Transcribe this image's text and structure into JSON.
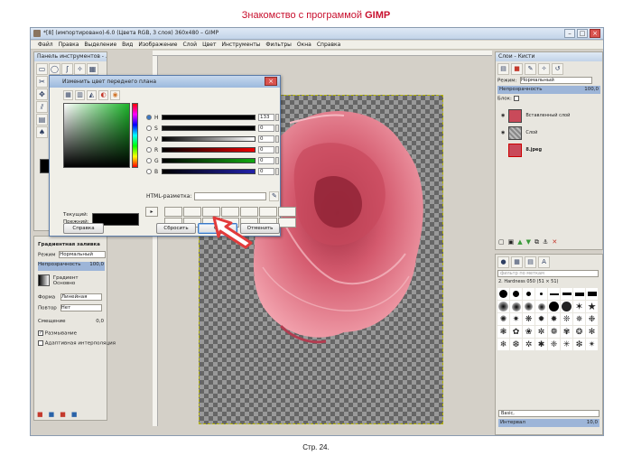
{
  "slide": {
    "title_prefix": "Знакомство с программой ",
    "title_strong": "GIMP",
    "page_label": "Стр. 24."
  },
  "window": {
    "title": "*[8] (импортировано)-6.0 (Цвета RGB, 3 слоя) 360x480 – GIMP"
  },
  "menu": [
    "Файл",
    "Правка",
    "Выделение",
    "Вид",
    "Изображение",
    "Слой",
    "Цвет",
    "Инструменты",
    "Фильтры",
    "Окна",
    "Справка"
  ],
  "toolbox": {
    "title": "Панель инструментов - ..."
  },
  "tool_options": {
    "title": "Градиентная заливка",
    "mode_label": "Режим",
    "mode_value": "Нормальный",
    "opacity_label": "Непрозрачность",
    "opacity_value": "100,0",
    "gradient_label": "Градиент",
    "gradient_value": "Основно",
    "shape_label": "Форма",
    "shape_value": "Линейная",
    "repeat_label": "Повтор",
    "repeat_value": "Нет",
    "offset_label": "Смещение",
    "offset_value": "0,0",
    "dither_label": "Размывание",
    "adaptive_label": "Адаптивная интерполяция"
  },
  "dialog": {
    "title": "Изменить цвет переднего плана",
    "sliders": [
      {
        "label": "H",
        "value": "133",
        "gradient": "linear-gradient(to right,#000,#000)"
      },
      {
        "label": "S",
        "value": "0",
        "gradient": "linear-gradient(to right,#fff,#000)"
      },
      {
        "label": "V",
        "value": "0",
        "gradient": "linear-gradient(to right,#000,#fff)"
      },
      {
        "label": "R",
        "value": "0",
        "gradient": "linear-gradient(to right,#000,#e00)"
      },
      {
        "label": "G",
        "value": "0",
        "gradient": "linear-gradient(to right,#000,#1a1)"
      },
      {
        "label": "B",
        "value": "0",
        "gradient": "linear-gradient(to right,#000,#22a)"
      }
    ],
    "html_label": "HTML-разметка:",
    "html_value": "",
    "current_label": "Текущий:",
    "previous_label": "Прежний:",
    "buttons": {
      "help": "Справка",
      "reset": "Сбросить",
      "ok": "OK",
      "cancel": "Отменить"
    }
  },
  "layers": {
    "title": "Слои - Кисти",
    "mode_label": "Режим:",
    "mode_value": "Нормальный",
    "opacity_label": "Непрозрачность",
    "opacity_value": "100,0",
    "lock_label": "Блок:",
    "items": [
      {
        "name": "Вставленный слой",
        "kind": "rose"
      },
      {
        "name": "Слой",
        "kind": "checker"
      },
      {
        "name": "8.jpeg",
        "kind": "rose"
      }
    ]
  },
  "brushes": {
    "filter_placeholder": "фильтр по меткам",
    "current_name": "2. Hardness 050 (51 × 51)",
    "spacing_label": "Интервал",
    "spacing_value": "10,0",
    "tag_label": "Basic,"
  },
  "colors": {
    "accent_red": "#c8102e",
    "rose": "#d9697a",
    "arrow": "#e23b3b"
  }
}
